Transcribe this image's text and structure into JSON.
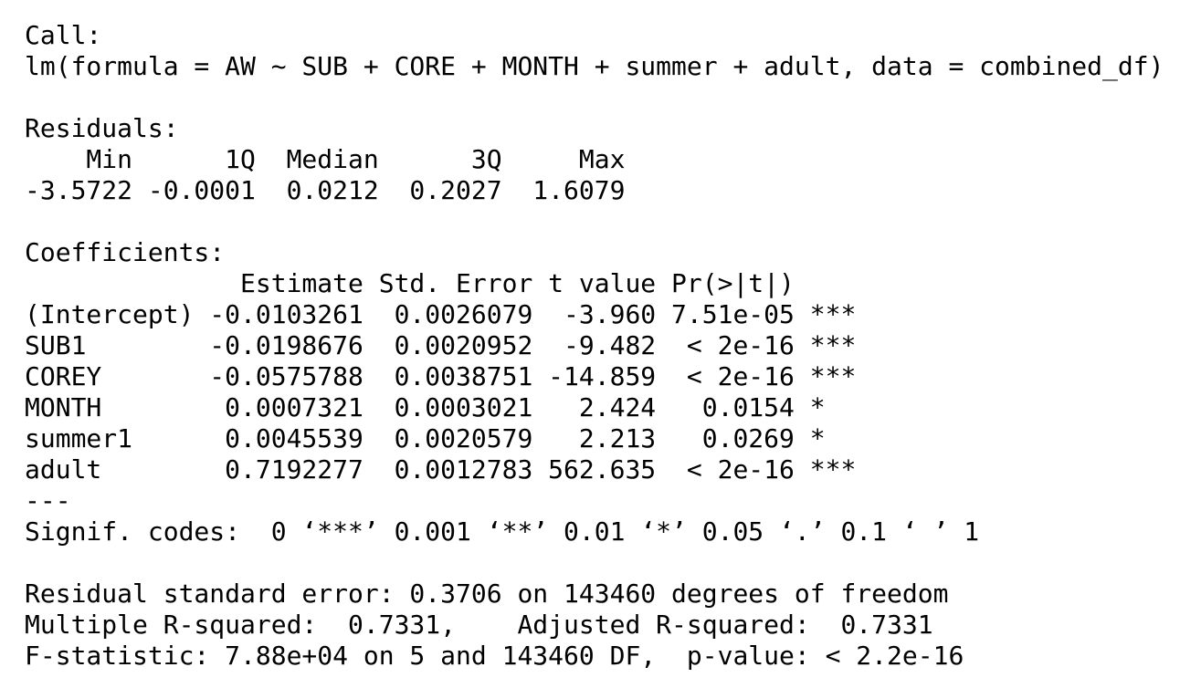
{
  "call": {
    "heading": "Call:",
    "formula": "lm(formula = AW ~ SUB + CORE + MONTH + summer + adult, data = combined_df)"
  },
  "residuals": {
    "heading": "Residuals:",
    "header": "    Min      1Q  Median      3Q     Max ",
    "values": "-3.5722 -0.0001  0.0212  0.2027  1.6079 "
  },
  "coefficients": {
    "heading": "Coefficients:",
    "header": "              Estimate Std. Error t value Pr(>|t|)    ",
    "rows": [
      "(Intercept) -0.0103261  0.0026079  -3.960 7.51e-05 ***",
      "SUB1        -0.0198676  0.0020952  -9.482  < 2e-16 ***",
      "COREY       -0.0575788  0.0038751 -14.859  < 2e-16 ***",
      "MONTH        0.0007321  0.0003021   2.424   0.0154 *  ",
      "summer1      0.0045539  0.0020579   2.213   0.0269 *  ",
      "adult        0.7192277  0.0012783 562.635  < 2e-16 ***"
    ],
    "separator": "---",
    "signif_codes": "Signif. codes:  0 ‘***’ 0.001 ‘**’ 0.01 ‘*’ 0.05 ‘.’ 0.1 ‘ ’ 1"
  },
  "summary": {
    "rse": "Residual standard error: 0.3706 on 143460 degrees of freedom",
    "r_squared": "Multiple R-squared:  0.7331,\tAdjusted R-squared:  0.7331 ",
    "f_statistic": "F-statistic: 7.88e+04 on 5 and 143460 DF,  p-value: < 2.2e-16"
  }
}
